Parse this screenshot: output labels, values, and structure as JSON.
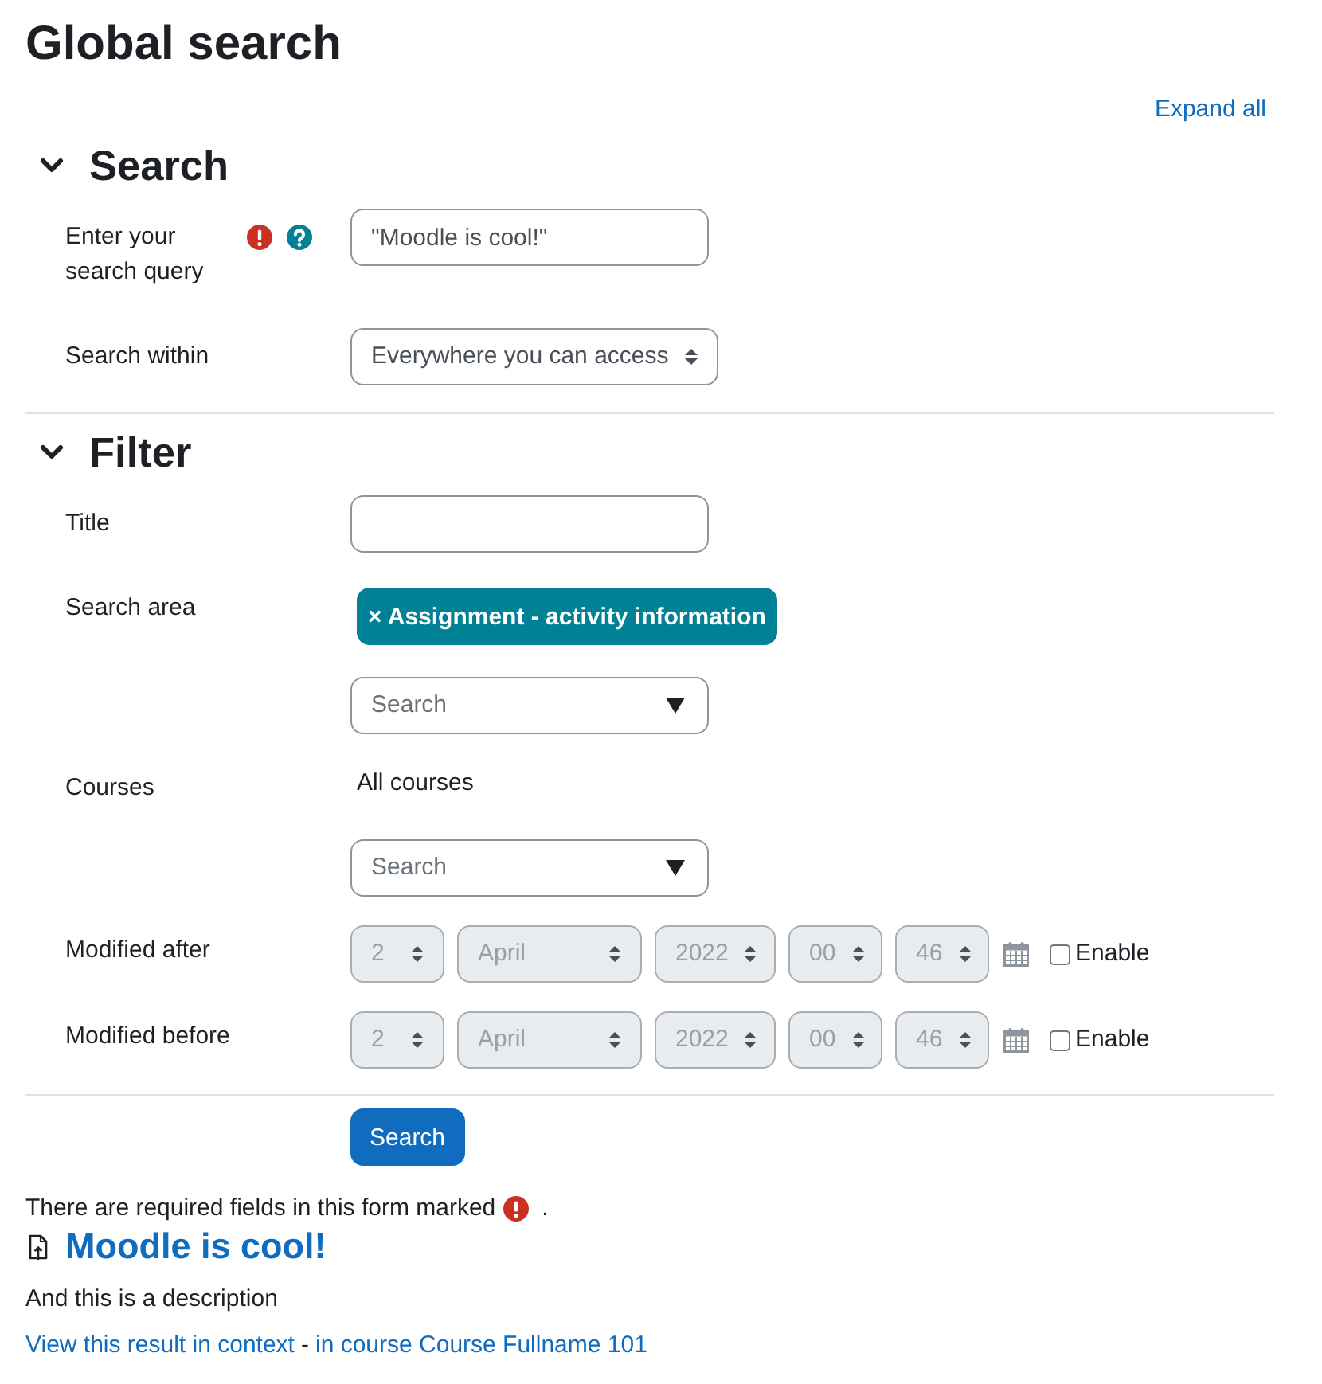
{
  "page": {
    "title": "Global search",
    "expand_all": "Expand all"
  },
  "sections": [
    {
      "title": "Search",
      "expanded": true,
      "fields": [
        {
          "kind": "text",
          "label": "Enter your search query",
          "value": "\"Moodle is cool!\"",
          "required": true,
          "help": true
        },
        {
          "kind": "select",
          "label": "Search within",
          "value": "Everywhere you can access"
        }
      ]
    },
    {
      "title": "Filter",
      "expanded": true,
      "fields": [
        {
          "kind": "text",
          "label": "Title",
          "required": false,
          "help": false
        },
        {
          "kind": "autocomplete",
          "label": "Search area",
          "chips": [
            {
              "remove": "×",
              "label": "Assignment - activity information"
            }
          ],
          "placeholder": "Search"
        },
        {
          "kind": "autocomplete",
          "label": "Courses",
          "empty_text": "All courses",
          "placeholder": "Search"
        },
        {
          "kind": "date",
          "label": "Modified after",
          "parts": [
            "2",
            "April",
            "2022",
            "00",
            "46"
          ],
          "enabled": false,
          "enable_label": "Enable"
        },
        {
          "kind": "date",
          "label": "Modified before",
          "parts": [
            "2",
            "April",
            "2022",
            "00",
            "46"
          ],
          "enabled": false,
          "enable_label": "Enable"
        }
      ]
    }
  ],
  "submit": "Search",
  "required_note": {
    "text": "There are required fields in this form marked",
    "end": "."
  },
  "results": [
    {
      "title": "Moodle is cool!",
      "description": "And this is a description",
      "context_link": "View this result in context",
      "separator": "-",
      "course_link": "in course Course Fullname 101"
    }
  ]
}
